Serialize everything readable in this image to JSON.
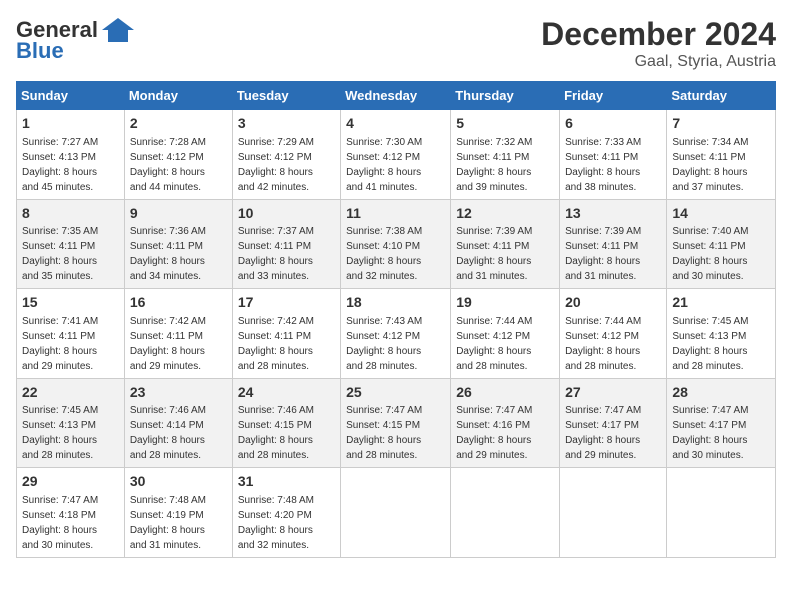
{
  "header": {
    "logo_line1": "General",
    "logo_line2": "Blue",
    "title": "December 2024",
    "subtitle": "Gaal, Styria, Austria"
  },
  "columns": [
    "Sunday",
    "Monday",
    "Tuesday",
    "Wednesday",
    "Thursday",
    "Friday",
    "Saturday"
  ],
  "weeks": [
    [
      {
        "day": "1",
        "info": "Sunrise: 7:27 AM\nSunset: 4:13 PM\nDaylight: 8 hours\nand 45 minutes."
      },
      {
        "day": "2",
        "info": "Sunrise: 7:28 AM\nSunset: 4:12 PM\nDaylight: 8 hours\nand 44 minutes."
      },
      {
        "day": "3",
        "info": "Sunrise: 7:29 AM\nSunset: 4:12 PM\nDaylight: 8 hours\nand 42 minutes."
      },
      {
        "day": "4",
        "info": "Sunrise: 7:30 AM\nSunset: 4:12 PM\nDaylight: 8 hours\nand 41 minutes."
      },
      {
        "day": "5",
        "info": "Sunrise: 7:32 AM\nSunset: 4:11 PM\nDaylight: 8 hours\nand 39 minutes."
      },
      {
        "day": "6",
        "info": "Sunrise: 7:33 AM\nSunset: 4:11 PM\nDaylight: 8 hours\nand 38 minutes."
      },
      {
        "day": "7",
        "info": "Sunrise: 7:34 AM\nSunset: 4:11 PM\nDaylight: 8 hours\nand 37 minutes."
      }
    ],
    [
      {
        "day": "8",
        "info": "Sunrise: 7:35 AM\nSunset: 4:11 PM\nDaylight: 8 hours\nand 35 minutes."
      },
      {
        "day": "9",
        "info": "Sunrise: 7:36 AM\nSunset: 4:11 PM\nDaylight: 8 hours\nand 34 minutes."
      },
      {
        "day": "10",
        "info": "Sunrise: 7:37 AM\nSunset: 4:11 PM\nDaylight: 8 hours\nand 33 minutes."
      },
      {
        "day": "11",
        "info": "Sunrise: 7:38 AM\nSunset: 4:10 PM\nDaylight: 8 hours\nand 32 minutes."
      },
      {
        "day": "12",
        "info": "Sunrise: 7:39 AM\nSunset: 4:11 PM\nDaylight: 8 hours\nand 31 minutes."
      },
      {
        "day": "13",
        "info": "Sunrise: 7:39 AM\nSunset: 4:11 PM\nDaylight: 8 hours\nand 31 minutes."
      },
      {
        "day": "14",
        "info": "Sunrise: 7:40 AM\nSunset: 4:11 PM\nDaylight: 8 hours\nand 30 minutes."
      }
    ],
    [
      {
        "day": "15",
        "info": "Sunrise: 7:41 AM\nSunset: 4:11 PM\nDaylight: 8 hours\nand 29 minutes."
      },
      {
        "day": "16",
        "info": "Sunrise: 7:42 AM\nSunset: 4:11 PM\nDaylight: 8 hours\nand 29 minutes."
      },
      {
        "day": "17",
        "info": "Sunrise: 7:42 AM\nSunset: 4:11 PM\nDaylight: 8 hours\nand 28 minutes."
      },
      {
        "day": "18",
        "info": "Sunrise: 7:43 AM\nSunset: 4:12 PM\nDaylight: 8 hours\nand 28 minutes."
      },
      {
        "day": "19",
        "info": "Sunrise: 7:44 AM\nSunset: 4:12 PM\nDaylight: 8 hours\nand 28 minutes."
      },
      {
        "day": "20",
        "info": "Sunrise: 7:44 AM\nSunset: 4:12 PM\nDaylight: 8 hours\nand 28 minutes."
      },
      {
        "day": "21",
        "info": "Sunrise: 7:45 AM\nSunset: 4:13 PM\nDaylight: 8 hours\nand 28 minutes."
      }
    ],
    [
      {
        "day": "22",
        "info": "Sunrise: 7:45 AM\nSunset: 4:13 PM\nDaylight: 8 hours\nand 28 minutes."
      },
      {
        "day": "23",
        "info": "Sunrise: 7:46 AM\nSunset: 4:14 PM\nDaylight: 8 hours\nand 28 minutes."
      },
      {
        "day": "24",
        "info": "Sunrise: 7:46 AM\nSunset: 4:15 PM\nDaylight: 8 hours\nand 28 minutes."
      },
      {
        "day": "25",
        "info": "Sunrise: 7:47 AM\nSunset: 4:15 PM\nDaylight: 8 hours\nand 28 minutes."
      },
      {
        "day": "26",
        "info": "Sunrise: 7:47 AM\nSunset: 4:16 PM\nDaylight: 8 hours\nand 29 minutes."
      },
      {
        "day": "27",
        "info": "Sunrise: 7:47 AM\nSunset: 4:17 PM\nDaylight: 8 hours\nand 29 minutes."
      },
      {
        "day": "28",
        "info": "Sunrise: 7:47 AM\nSunset: 4:17 PM\nDaylight: 8 hours\nand 30 minutes."
      }
    ],
    [
      {
        "day": "29",
        "info": "Sunrise: 7:47 AM\nSunset: 4:18 PM\nDaylight: 8 hours\nand 30 minutes."
      },
      {
        "day": "30",
        "info": "Sunrise: 7:48 AM\nSunset: 4:19 PM\nDaylight: 8 hours\nand 31 minutes."
      },
      {
        "day": "31",
        "info": "Sunrise: 7:48 AM\nSunset: 4:20 PM\nDaylight: 8 hours\nand 32 minutes."
      },
      {
        "day": "",
        "info": ""
      },
      {
        "day": "",
        "info": ""
      },
      {
        "day": "",
        "info": ""
      },
      {
        "day": "",
        "info": ""
      }
    ]
  ]
}
